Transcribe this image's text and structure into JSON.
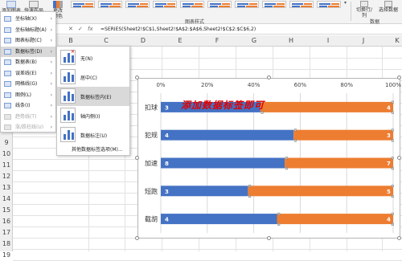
{
  "ribbon": {
    "left_btn_1": "添加图表",
    "left_btn_1b": "元素",
    "left_btn_2": "快速布局",
    "left_btn_3": "更改",
    "left_btn_3b": "颜色",
    "group_label": "图表样式",
    "right_btn_1": "切换行/列",
    "right_btn_2": "选择数据",
    "right_group": "数据"
  },
  "formula": {
    "text": "=SERIES(Sheet2!$C$1,Sheet2!$A$2:$A$6,Sheet2!$C$2:$C$6,2)",
    "fx": "fx",
    "cancel": "✕",
    "enter": "✓"
  },
  "columns": [
    "B",
    "C",
    "D",
    "E",
    "F",
    "G",
    "H",
    "I",
    "J",
    "K"
  ],
  "rows": [
    "",
    "",
    "",
    "",
    "",
    "",
    "",
    "",
    "9",
    "10",
    "11",
    "12",
    "13",
    "14",
    "15",
    "16",
    "17",
    "18",
    "19"
  ],
  "main_menu": {
    "items": [
      {
        "label": "坐标轴(X)",
        "icon": "axis-icon",
        "arrow": true,
        "disabled": false
      },
      {
        "label": "坐标轴标题(A)",
        "icon": "axis-title-icon",
        "arrow": true,
        "disabled": false
      },
      {
        "label": "图表标题(C)",
        "icon": "chart-title-icon",
        "arrow": true,
        "disabled": false
      },
      {
        "label": "数据标签(D)",
        "icon": "data-label-icon",
        "arrow": true,
        "disabled": false
      },
      {
        "label": "数据表(B)",
        "icon": "data-table-icon",
        "arrow": true,
        "disabled": false
      },
      {
        "label": "误差线(E)",
        "icon": "error-bar-icon",
        "arrow": true,
        "disabled": false
      },
      {
        "label": "网格线(G)",
        "icon": "gridline-icon",
        "arrow": true,
        "disabled": false
      },
      {
        "label": "图例(L)",
        "icon": "legend-icon",
        "arrow": true,
        "disabled": false
      },
      {
        "label": "线条(I)",
        "icon": "lines-icon",
        "arrow": true,
        "disabled": false
      },
      {
        "label": "趋势线(T)",
        "icon": "trendline-icon",
        "arrow": true,
        "disabled": true
      },
      {
        "label": "涨/跌柱线(U)",
        "icon": "updown-bars-icon",
        "arrow": true,
        "disabled": true
      }
    ]
  },
  "sub_menu": {
    "items": [
      {
        "label": "无(N)"
      },
      {
        "label": "居中(C)"
      },
      {
        "label": "数据标签内(E)"
      },
      {
        "label": "轴内侧(I)"
      },
      {
        "label": "数据标注(U)"
      }
    ],
    "more": "其他数据标签选项(M)..."
  },
  "annotation": "添加数据标签即可",
  "colors": {
    "series1": "#4472c4",
    "series2": "#ed7d31",
    "annotation": "#e00000",
    "highlight": "#d9d9d9"
  },
  "chart_data": {
    "type": "bar",
    "stacked": "100%",
    "orientation": "horizontal",
    "categories": [
      "扣球",
      "犯规",
      "加速",
      "短跑",
      "截胡"
    ],
    "series": [
      {
        "values": [
          3,
          4,
          8,
          3,
          4
        ],
        "color": "#4472c4"
      },
      {
        "values": [
          4,
          3,
          7,
          5,
          4
        ],
        "color": "#ed7d31"
      }
    ],
    "x_ticks": [
      "0%",
      "20%",
      "40%",
      "60%",
      "80%",
      "100%"
    ],
    "xlim": [
      0,
      100
    ],
    "x_axis_position": "top",
    "grid": true,
    "legend": "none"
  }
}
